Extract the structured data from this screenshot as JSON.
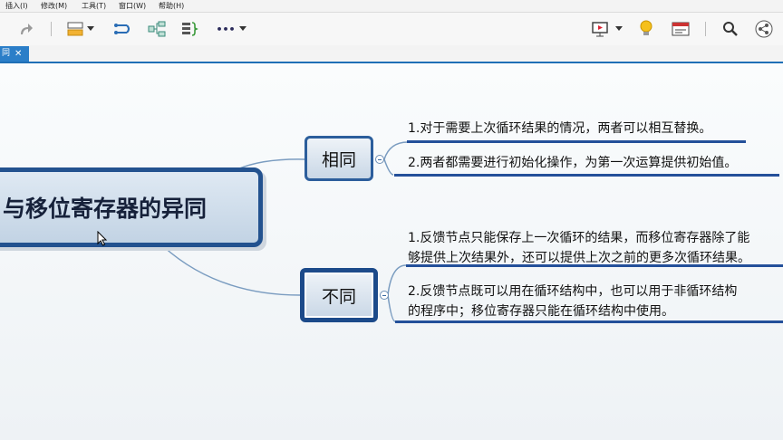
{
  "menu": {
    "items": [
      "插入(I)",
      "修改(M)",
      "工具(T)",
      "窗口(W)",
      "帮助(H)"
    ]
  },
  "toolbar": {
    "icons": [
      "redo-icon",
      "topic-style-icon",
      "relationship-icon",
      "structure-icon",
      "summary-icon",
      "more-icon",
      "presentation-icon",
      "idea-icon",
      "layout-icon",
      "search-icon",
      "share-icon"
    ],
    "more_label": "•••"
  },
  "tab": {
    "label": "同",
    "close": "✕"
  },
  "mindmap": {
    "central_topic": "与移位寄存器的异同",
    "branches": [
      {
        "label": "相同",
        "items": [
          "1.对于需要上次循环结果的情况，两者可以相互替换。",
          "2.两者都需要进行初始化操作，为第一次运算提供初始值。"
        ]
      },
      {
        "label": "不同",
        "items": [
          [
            "1.反馈节点只能保存上一次循环的结果，而移位寄存器除了能",
            "够提供上次结果外，还可以提供上次之前的更多次循环结果。"
          ],
          [
            "2.反馈节点既可以用在循环结构中，也可以用于非循环结构",
            "的程序中；移位寄存器只能在循环结构中使用。"
          ]
        ]
      }
    ]
  },
  "colors": {
    "accent": "#23528f",
    "tab_blue": "#2b7ec8",
    "line": "#7a9cc0"
  }
}
